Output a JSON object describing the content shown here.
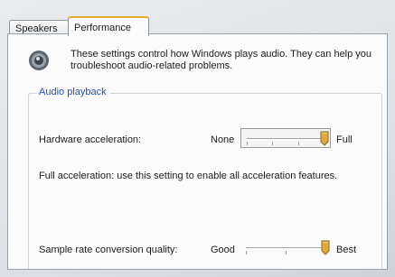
{
  "tabs": [
    {
      "label": "Speakers",
      "active": false
    },
    {
      "label": "Performance",
      "active": true
    }
  ],
  "intro_text": "These settings control how Windows plays audio. They can help you troubleshoot audio-related problems.",
  "section_title": "Audio playback",
  "hardware_acceleration": {
    "label": "Hardware acceleration:",
    "min_label": "None",
    "max_label": "Full",
    "level": 1.0,
    "description": "Full acceleration: use this setting to enable all acceleration features."
  },
  "sample_rate": {
    "label": "Sample rate conversion quality:",
    "min_label": "Good",
    "max_label": "Best",
    "level": 1.0
  },
  "colors": {
    "accent_tab": "#e6a936",
    "section_title": "#1d54b8",
    "thumb": "#e0a93a"
  },
  "icons": {
    "speaker": "speaker-icon"
  }
}
